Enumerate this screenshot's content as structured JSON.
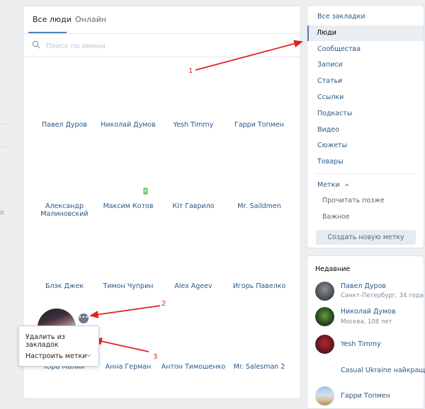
{
  "tabs": [
    "Все люди",
    "Онлайн"
  ],
  "search": {
    "placeholder": "Поиск по имени"
  },
  "people": [
    "Павел Дуров",
    "Николай Думов",
    "Yesh Timmy",
    "Гарри Топмен",
    "Александр Малиновский",
    "Максим Котов",
    "Кіт Гаврило",
    "Mr. Saildmen",
    "Блэк Джек",
    "Тимон Чуприн",
    "Alex Ageev",
    "Игорь Павелко",
    "Юра Малий",
    "Анна Герман",
    "Антон Тимошенко",
    "Mr. Salesman 2"
  ],
  "context_menu": {
    "items": [
      "Удалить из закладок",
      "Настроить метки"
    ]
  },
  "sidebar": {
    "items": [
      "Все закладки",
      "Люди",
      "Сообщества",
      "Записи",
      "Статьи",
      "Ссылки",
      "Подкасты",
      "Видео",
      "Сюжеты",
      "Товары"
    ],
    "active": "Люди",
    "tags_label": "Метки",
    "tags": [
      "Прочитать позже",
      "Важное"
    ],
    "create_button": "Создать новую метку"
  },
  "recent": {
    "title": "Недавние",
    "items": [
      {
        "name": "Павел Дуров",
        "subtitle": "Санкт-Петербург, 34 года"
      },
      {
        "name": "Николай Думов",
        "subtitle": "Москва, 108 лет"
      },
      {
        "name": "Yesh Timmy",
        "subtitle": ""
      },
      {
        "name": "Casual Ukraine найкращ...",
        "subtitle": ""
      },
      {
        "name": "Гарри Топмен",
        "subtitle": ""
      }
    ]
  },
  "annotations": [
    "1",
    "2",
    "3"
  ],
  "colors": {
    "accent": "#5181b8",
    "link": "#2a5885",
    "arrow": "#e22121"
  }
}
